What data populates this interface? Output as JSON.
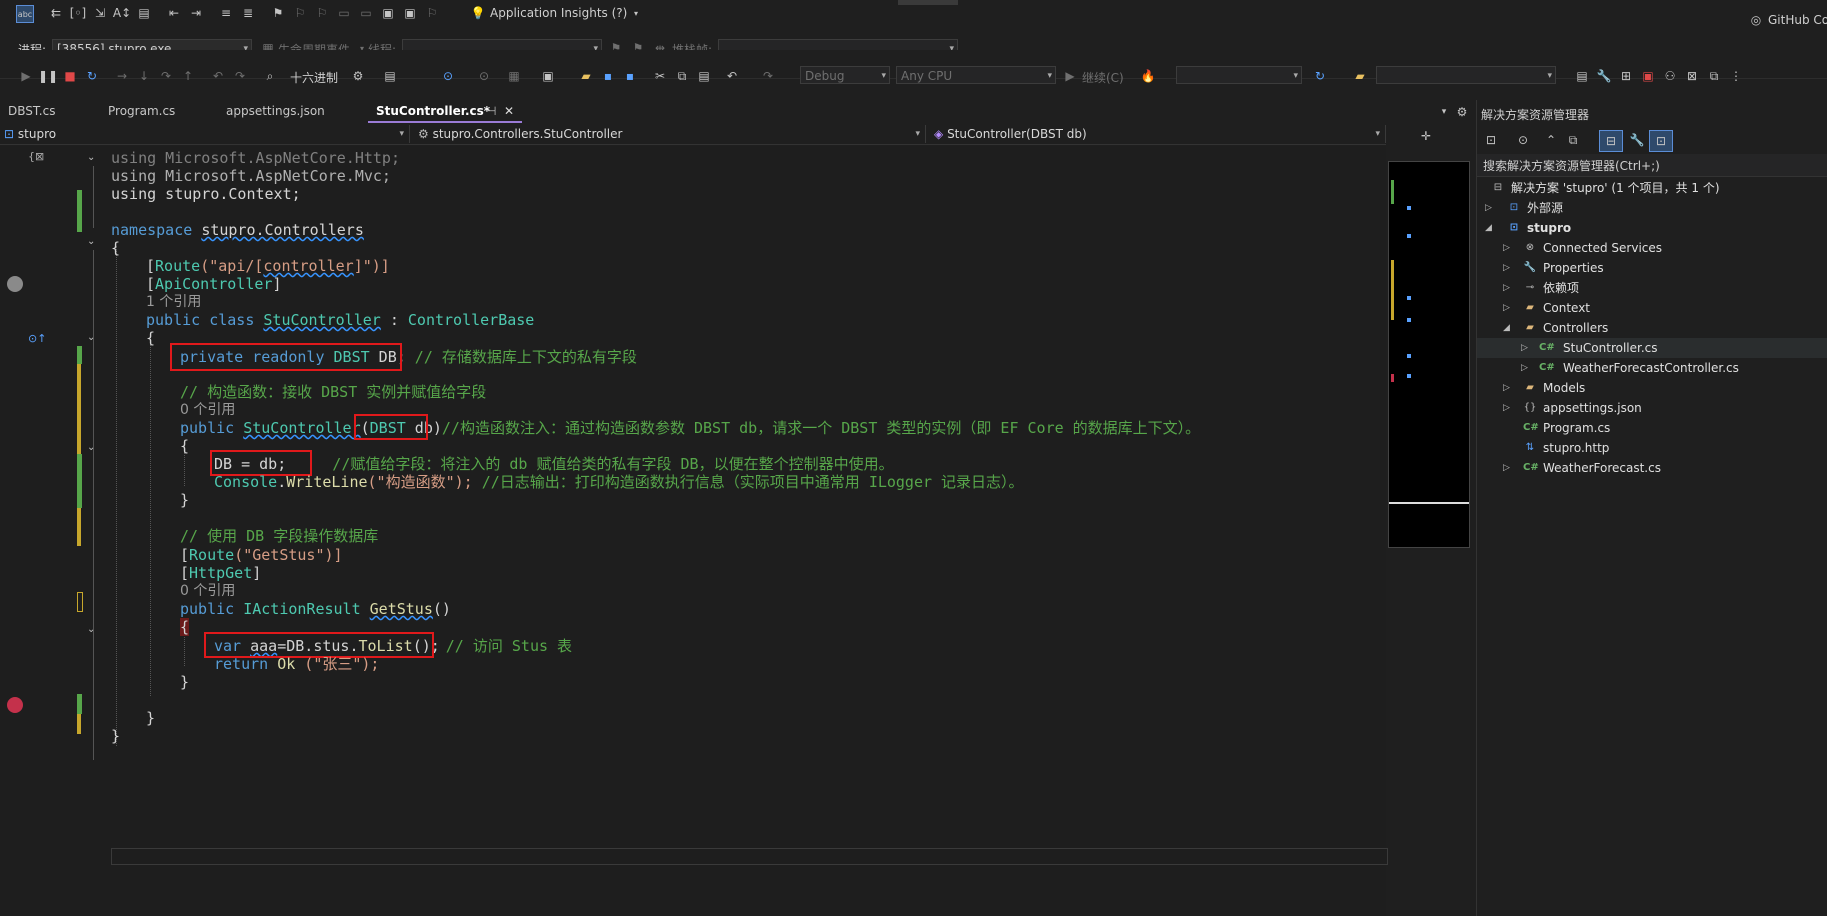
{
  "toolbar1": {
    "app_insights": "Application Insights (?)",
    "github": "GitHub Co"
  },
  "toolbar2": {
    "process_label": "进程:",
    "process_value": "[38556] stupro.exe",
    "lifecycle": "生命周期事件",
    "thread_label": "线程:",
    "stackframe_label": "堆栈帧:"
  },
  "toolbar3": {
    "hex": "十六进制",
    "config": "Debug",
    "platform": "Any CPU",
    "continue": "继续(C)"
  },
  "tabs": [
    {
      "label": "DBST.cs"
    },
    {
      "label": "Program.cs"
    },
    {
      "label": "appsettings.json"
    },
    {
      "label": "StuController.cs*"
    }
  ],
  "nav": {
    "project": "stupro",
    "type": "stupro.Controllers.StuController",
    "member": "StuController(DBST db)"
  },
  "code": {
    "l1": "using Microsoft.AspNetCore.Http;",
    "l2": "using Microsoft.AspNetCore.Mvc;",
    "l3": "using stupro.Context;",
    "l5a": "namespace ",
    "l5b": "stupro.Controllers",
    "l6": "{",
    "l7a": "[",
    "l7b": "Route",
    "l7c": "(\"api/[",
    "l7d": "controller",
    "l7e": "]\")]",
    "l8a": "[",
    "l8b": "ApiController",
    "l8c": "]",
    "l9": "1 个引用",
    "l10a": "public class ",
    "l10b": "StuController",
    "l10c": " : ",
    "l10d": "ControllerBase",
    "l11": "{",
    "l12a": "private readonly ",
    "l12b": "DBST",
    "l12c": " DB;",
    "l12d": " // 存储数据库上下文的私有字段",
    "l14": "// 构造函数：接收 DBST 实例并赋值给字段",
    "l15": "0 个引用",
    "l16a": "public ",
    "l16b": "StuController",
    "l16c": "(",
    "l16d": "DBST",
    "l16e": " db)",
    "l16f": "//构造函数注入：通过构造函数参数 DBST db，请求一个 DBST 类型的实例（即 EF Core 的数据库上下文）。",
    "l17": "{",
    "l18a": "DB = db;",
    "l18b": "  //赋值给字段：将注入的 db 赋值给类的私有字段 DB，以便在整个控制器中使用。",
    "l19a": "Console",
    "l19b": ".",
    "l19c": "WriteLine",
    "l19d": "(\"构造函数\");",
    "l19e": " //日志输出：打印构造函数执行信息（实际项目中通常用 ILogger 记录日志）。",
    "l20": "}",
    "l22": "// 使用 DB 字段操作数据库",
    "l23a": "[",
    "l23b": "Route",
    "l23c": "(\"GetStus\")]",
    "l24a": "[",
    "l24b": "HttpGet",
    "l24c": "]",
    "l25": "0 个引用",
    "l26a": "public ",
    "l26b": "IActionResult",
    "l26c": " ",
    "l26d": "GetStus",
    "l26e": "()",
    "l27": "{",
    "l28a": "var ",
    "l28b": "aaa",
    "l28c": "=DB.stus.",
    "l28d": "ToList",
    "l28e": "();",
    "l28f": "// 访问 Stus 表",
    "l29a": "return ",
    "l29b": "Ok",
    "l29c": " (\"张三\");",
    "l30": "}",
    "l32": "}",
    "l33": "}"
  },
  "solution_explorer": {
    "title": "解决方案资源管理器",
    "search": "搜索解决方案资源管理器(Ctrl+;)",
    "items": [
      {
        "label": "解决方案 'stupro' (1 个项目，共 1 个)",
        "icon": "solution-icon"
      },
      {
        "label": "外部源",
        "icon": "external-icon"
      },
      {
        "label": "stupro",
        "icon": "project-icon"
      },
      {
        "label": "Connected Services",
        "icon": "connected-icon"
      },
      {
        "label": "Properties",
        "icon": "properties-icon"
      },
      {
        "label": "依赖项",
        "icon": "dependencies-icon"
      },
      {
        "label": "Context",
        "icon": "folder-icon"
      },
      {
        "label": "Controllers",
        "icon": "folder-icon"
      },
      {
        "label": "StuController.cs",
        "icon": "csharp-icon"
      },
      {
        "label": "WeatherForecastController.cs",
        "icon": "csharp-icon"
      },
      {
        "label": "Models",
        "icon": "folder-icon"
      },
      {
        "label": "appsettings.json",
        "icon": "json-icon"
      },
      {
        "label": "Program.cs",
        "icon": "csharp-icon"
      },
      {
        "label": "stupro.http",
        "icon": "http-icon"
      },
      {
        "label": "WeatherForecast.cs",
        "icon": "csharp-icon"
      }
    ]
  }
}
